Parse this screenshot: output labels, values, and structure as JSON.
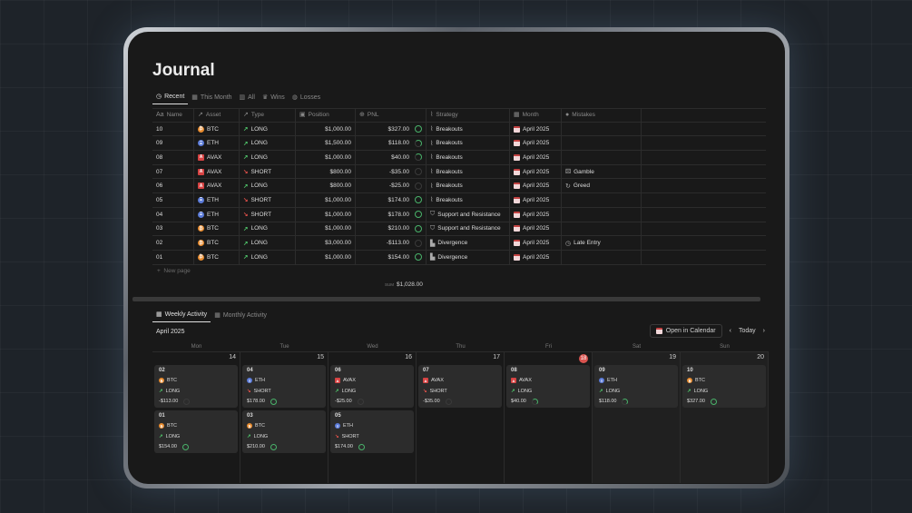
{
  "title": "Journal",
  "views": [
    {
      "label": "Recent",
      "icon": "clock-icon",
      "active": true
    },
    {
      "label": "This Month",
      "icon": "calendar-icon"
    },
    {
      "label": "All",
      "icon": "chart-icon"
    },
    {
      "label": "Wins",
      "icon": "trophy-icon"
    },
    {
      "label": "Losses",
      "icon": "loss-icon"
    }
  ],
  "columns": [
    "Name",
    "Asset",
    "Type",
    "Position",
    "PNL",
    "Strategy",
    "Month",
    "Mistakes"
  ],
  "rows": [
    {
      "name": "10",
      "asset": "BTC",
      "type": "LONG",
      "position": "$1,000.00",
      "pnl": "$327.00",
      "progress": 1.0,
      "strategy": "Breakouts",
      "month": "April 2025",
      "mistake": ""
    },
    {
      "name": "09",
      "asset": "ETH",
      "type": "LONG",
      "position": "$1,500.00",
      "pnl": "$118.00",
      "progress": 0.8,
      "strategy": "Breakouts",
      "month": "April 2025",
      "mistake": ""
    },
    {
      "name": "08",
      "asset": "AVAX",
      "type": "LONG",
      "position": "$1,000.00",
      "pnl": "$40.00",
      "progress": 0.4,
      "strategy": "Breakouts",
      "month": "April 2025",
      "mistake": ""
    },
    {
      "name": "07",
      "asset": "AVAX",
      "type": "SHORT",
      "position": "$800.00",
      "pnl": "-$35.00",
      "progress": 0,
      "strategy": "Breakouts",
      "month": "April 2025",
      "mistake": "Gamble"
    },
    {
      "name": "06",
      "asset": "AVAX",
      "type": "LONG",
      "position": "$800.00",
      "pnl": "-$25.00",
      "progress": 0,
      "strategy": "Breakouts",
      "month": "April 2025",
      "mistake": "Greed"
    },
    {
      "name": "05",
      "asset": "ETH",
      "type": "SHORT",
      "position": "$1,000.00",
      "pnl": "$174.00",
      "progress": 1.0,
      "strategy": "Breakouts",
      "month": "April 2025",
      "mistake": ""
    },
    {
      "name": "04",
      "asset": "ETH",
      "type": "SHORT",
      "position": "$1,000.00",
      "pnl": "$178.00",
      "progress": 1.0,
      "strategy": "Support and Resistance",
      "month": "April 2025",
      "mistake": ""
    },
    {
      "name": "03",
      "asset": "BTC",
      "type": "LONG",
      "position": "$1,000.00",
      "pnl": "$210.00",
      "progress": 1.0,
      "strategy": "Support and Resistance",
      "month": "April 2025",
      "mistake": ""
    },
    {
      "name": "02",
      "asset": "BTC",
      "type": "LONG",
      "position": "$3,000.00",
      "pnl": "-$113.00",
      "progress": 0,
      "strategy": "Divergence",
      "month": "April 2025",
      "mistake": "Late Entry"
    },
    {
      "name": "01",
      "asset": "BTC",
      "type": "LONG",
      "position": "$1,000.00",
      "pnl": "$154.00",
      "progress": 1.0,
      "strategy": "Divergence",
      "month": "April 2025",
      "mistake": ""
    }
  ],
  "new_page": "New page",
  "sum_label": "SUM",
  "sum_value": "$1,028.00",
  "tabs2": [
    {
      "label": "Weekly Activity",
      "active": true
    },
    {
      "label": "Monthly Activity"
    }
  ],
  "calendar": {
    "month": "April 2025",
    "open_label": "Open in Calendar",
    "today_label": "Today",
    "weekdays": [
      "Mon",
      "Tue",
      "Wed",
      "Thu",
      "Fri",
      "Sat",
      "Sun"
    ],
    "days": [
      {
        "num": "14",
        "cards": [
          {
            "name": "02",
            "asset": "BTC",
            "type": "LONG",
            "pnl": "-$113.00",
            "progress": 0
          },
          {
            "name": "01",
            "asset": "BTC",
            "type": "LONG",
            "pnl": "$154.00",
            "progress": 1.0
          }
        ]
      },
      {
        "num": "15",
        "cards": [
          {
            "name": "04",
            "asset": "ETH",
            "type": "SHORT",
            "pnl": "$178.00",
            "progress": 1.0
          },
          {
            "name": "03",
            "asset": "BTC",
            "type": "LONG",
            "pnl": "$210.00",
            "progress": 1.0
          }
        ]
      },
      {
        "num": "16",
        "cards": [
          {
            "name": "06",
            "asset": "AVAX",
            "type": "LONG",
            "pnl": "-$25.00",
            "progress": 0
          },
          {
            "name": "05",
            "asset": "ETH",
            "type": "SHORT",
            "pnl": "$174.00",
            "progress": 1.0
          }
        ]
      },
      {
        "num": "17",
        "cards": [
          {
            "name": "07",
            "asset": "AVAX",
            "type": "SHORT",
            "pnl": "-$35.00",
            "progress": 0
          }
        ]
      },
      {
        "num": "18",
        "today": true,
        "cards": [
          {
            "name": "08",
            "asset": "AVAX",
            "type": "LONG",
            "pnl": "$40.00",
            "progress": 0.4
          }
        ]
      },
      {
        "num": "19",
        "cards": [
          {
            "name": "09",
            "asset": "ETH",
            "type": "LONG",
            "pnl": "$118.00",
            "progress": 0.8
          }
        ]
      },
      {
        "num": "20",
        "cards": [
          {
            "name": "10",
            "asset": "BTC",
            "type": "LONG",
            "pnl": "$327.00",
            "progress": 1.0
          }
        ]
      }
    ]
  }
}
